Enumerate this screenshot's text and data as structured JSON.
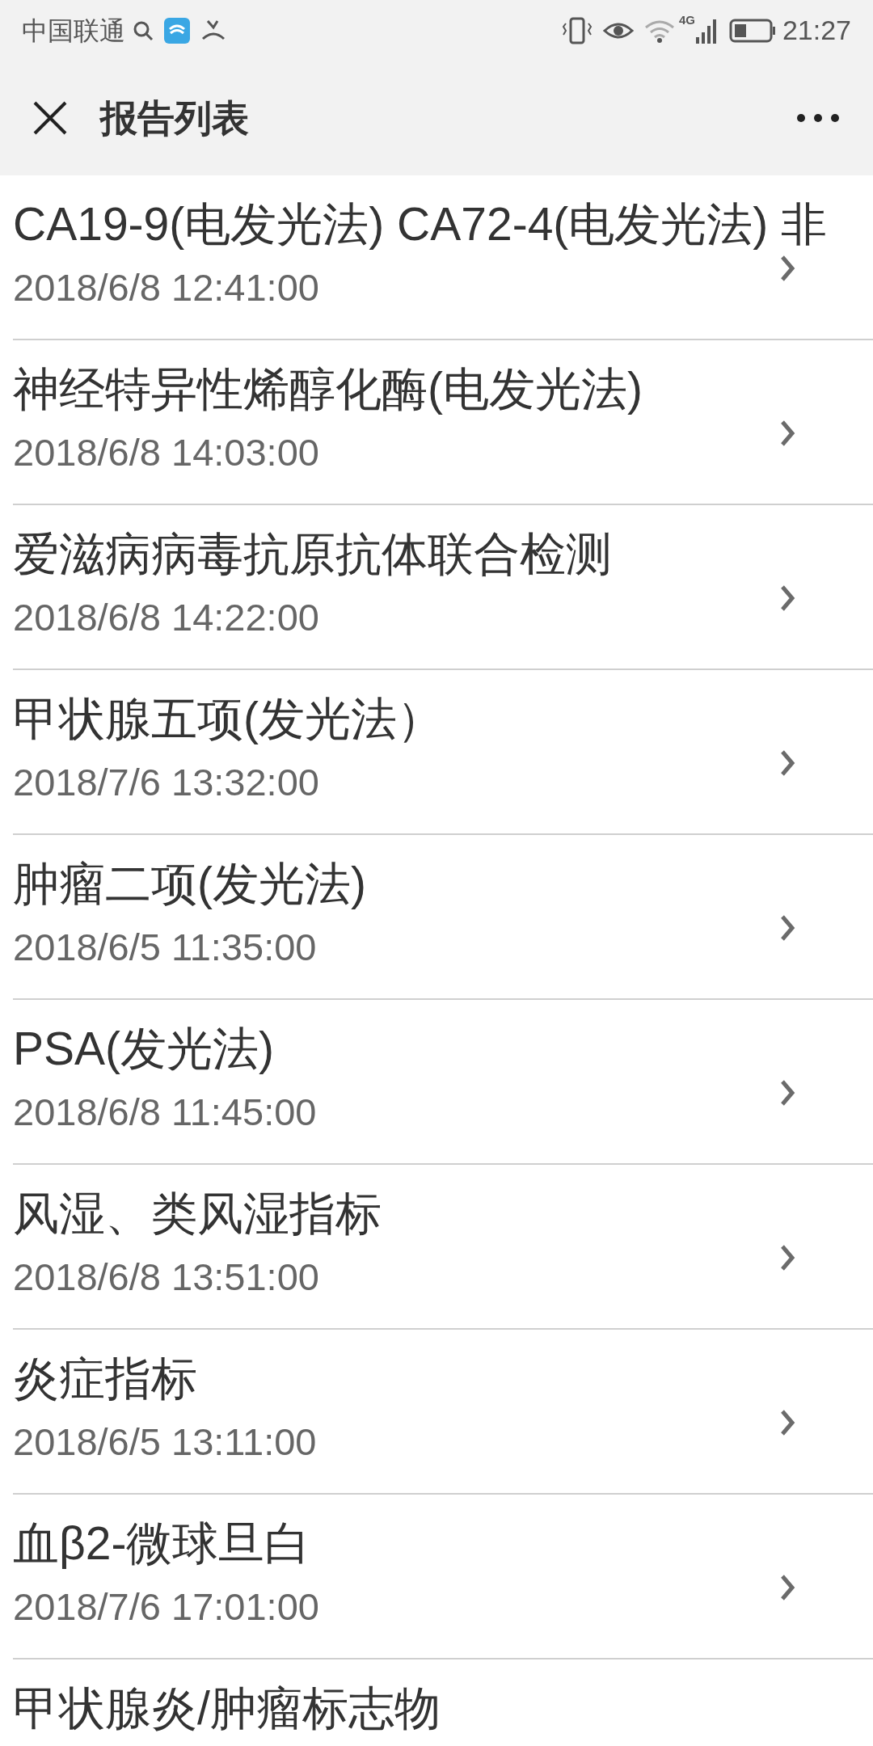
{
  "status_bar": {
    "carrier": "中国联通",
    "time": "21:27",
    "network": "4G"
  },
  "header": {
    "title": "报告列表"
  },
  "reports": [
    {
      "title": "CA19-9(电发光法) CA72-4(电发光法) 非",
      "date": "2018/6/8 12:41:00"
    },
    {
      "title": "神经特异性烯醇化酶(电发光法)",
      "date": "2018/6/8 14:03:00"
    },
    {
      "title": "爱滋病病毒抗原抗体联合检测",
      "date": "2018/6/8 14:22:00"
    },
    {
      "title": "甲状腺五项(发光法）",
      "date": "2018/7/6 13:32:00"
    },
    {
      "title": "肿瘤二项(发光法)",
      "date": "2018/6/5 11:35:00"
    },
    {
      "title": "PSA(发光法)",
      "date": "2018/6/8 11:45:00"
    },
    {
      "title": "风湿、类风湿指标",
      "date": "2018/6/8 13:51:00"
    },
    {
      "title": "炎症指标",
      "date": "2018/6/5 13:11:00"
    },
    {
      "title": "血β2-微球旦白",
      "date": "2018/7/6 17:01:00"
    },
    {
      "title": "甲状腺炎/肿瘤标志物"
    }
  ]
}
